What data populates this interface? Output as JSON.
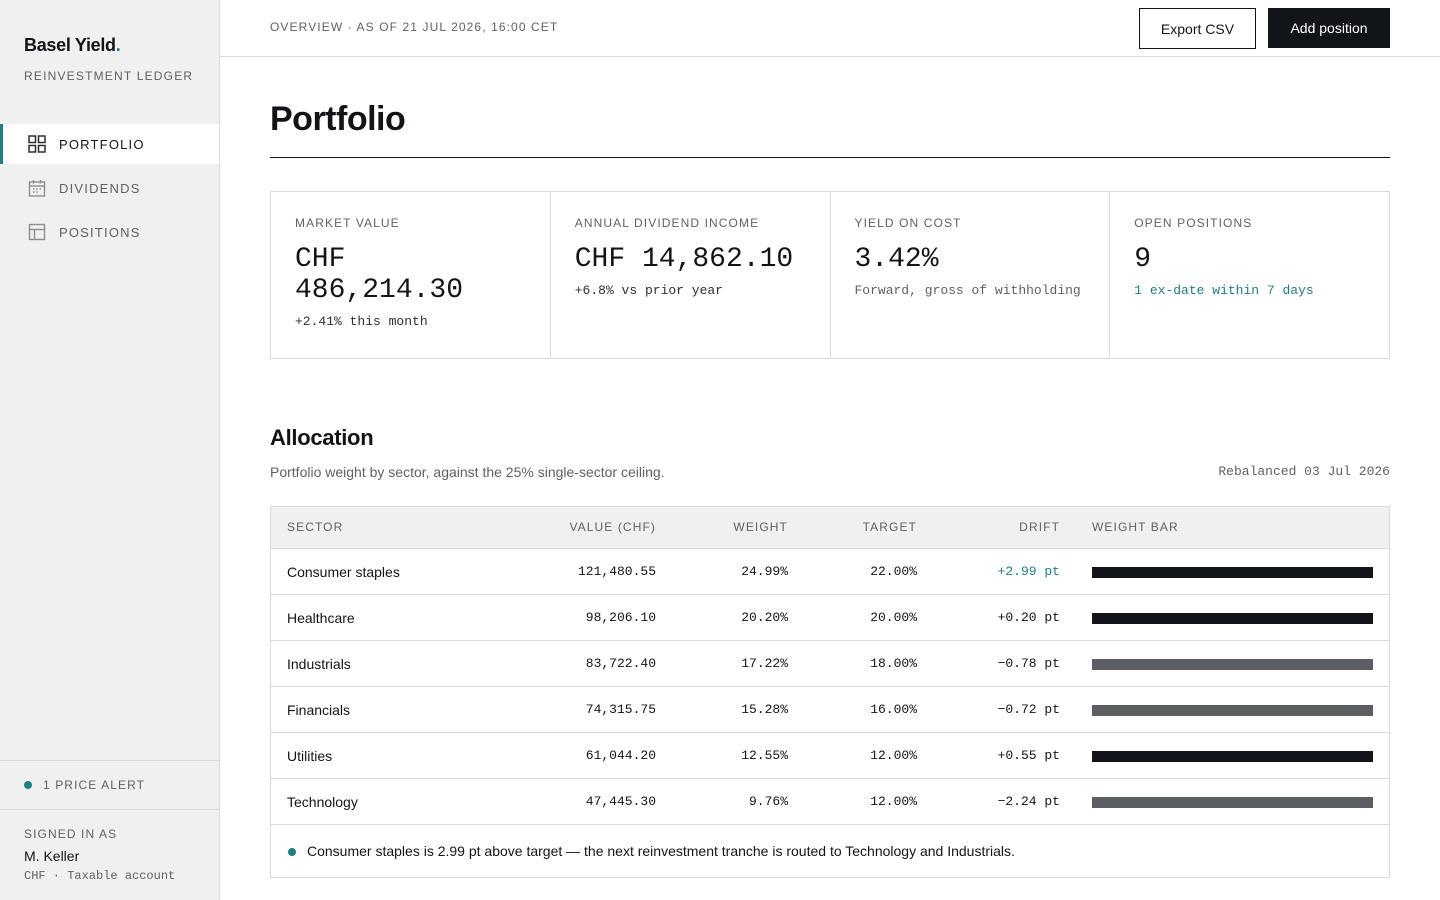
{
  "brand": {
    "name": "Basel Yield",
    "dot": ".",
    "subtitle": "REINVESTMENT LEDGER"
  },
  "nav": [
    {
      "label": "PORTFOLIO",
      "icon": "grid-icon",
      "active": true
    },
    {
      "label": "DIVIDENDS",
      "icon": "calendar-icon",
      "active": false
    },
    {
      "label": "POSITIONS",
      "icon": "table-icon",
      "active": false
    }
  ],
  "alert": {
    "label": "1 PRICE ALERT"
  },
  "user": {
    "signed_label": "SIGNED IN AS",
    "name": "M. Keller",
    "account": "CHF · Taxable account"
  },
  "header": {
    "breadcrumb": "OVERVIEW · AS OF 21 JUL 2026, 16:00 CET",
    "export_label": "Export CSV",
    "add_label": "Add position"
  },
  "page": {
    "title": "Portfolio"
  },
  "kpis": [
    {
      "label": "MARKET VALUE",
      "value_line1": "CHF",
      "value_line2": "486,214.30",
      "note": "+2.41% this month",
      "tone": "default"
    },
    {
      "label": "ANNUAL DIVIDEND INCOME",
      "value_line1": "CHF 14,862.10",
      "value_line2": "",
      "note": "+6.8% vs prior year",
      "tone": "default"
    },
    {
      "label": "YIELD ON COST",
      "value_line1": "3.42%",
      "value_line2": "",
      "note": "Forward, gross of withholding",
      "tone": "muted"
    },
    {
      "label": "OPEN POSITIONS",
      "value_line1": "9",
      "value_line2": "",
      "note": "1 ex-date within 7 days",
      "tone": "accent"
    }
  ],
  "allocation": {
    "title": "Allocation",
    "subtitle": "Portfolio weight by sector, against the 25% single-sector ceiling.",
    "meta": "Rebalanced 03 Jul 2026",
    "columns": [
      "SECTOR",
      "VALUE (CHF)",
      "WEIGHT",
      "TARGET",
      "DRIFT",
      "WEIGHT BAR"
    ],
    "rows": [
      {
        "sector": "Consumer staples",
        "value": "121,480.55",
        "weight": "24.99%",
        "target": "22.00%",
        "drift": "+2.99 pt",
        "bar_fill": 1.0,
        "drift_tone": "accent"
      },
      {
        "sector": "Healthcare",
        "value": "98,206.10",
        "weight": "20.20%",
        "target": "20.00%",
        "drift": "+0.20 pt",
        "bar_fill": 1.0,
        "drift_tone": "default"
      },
      {
        "sector": "Industrials",
        "value": "83,722.40",
        "weight": "17.22%",
        "target": "18.00%",
        "drift": "−0.78 pt",
        "bar_fill": 1.0,
        "drift_tone": "default"
      },
      {
        "sector": "Financials",
        "value": "74,315.75",
        "weight": "15.28%",
        "target": "16.00%",
        "drift": "−0.72 pt",
        "bar_fill": 1.0,
        "drift_tone": "default"
      },
      {
        "sector": "Utilities",
        "value": "61,044.20",
        "weight": "12.55%",
        "target": "12.00%",
        "drift": "+0.55 pt",
        "bar_fill": 1.0,
        "drift_tone": "default"
      },
      {
        "sector": "Technology",
        "value": "47,445.30",
        "weight": "9.76%",
        "target": "12.00%",
        "drift": "−2.24 pt",
        "bar_fill": 1.0,
        "drift_tone": "default"
      }
    ],
    "footnote": "Consumer staples is 2.99 pt above target — the next reinvestment tranche is routed to Technology and Industrials."
  },
  "colors": {
    "accent": "#1b7f86",
    "ink": "#111418",
    "bar_over": "#111418",
    "bar_under": "#5b5f64",
    "sidebar_bg": "#f0f0f0"
  }
}
